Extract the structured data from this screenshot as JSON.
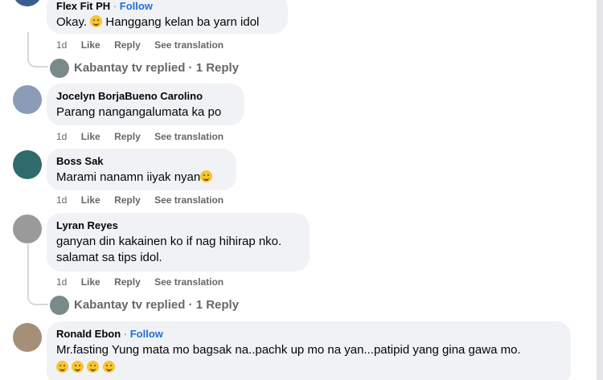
{
  "comments": [
    {
      "author": "Flex Fit PH",
      "separator": " · ",
      "follow": "Follow",
      "text": "Okay.",
      "text_after_emoji": " Hanggang kelan ba yarn idol",
      "time": "1d",
      "like": "Like",
      "reply": "Reply",
      "translate": "See translation"
    },
    {
      "author": "Jocelyn BorjaBueno Carolino",
      "text": "Parang nangangalumata ka po",
      "time": "1d",
      "like": "Like",
      "reply": "Reply",
      "translate": "See translation"
    },
    {
      "author": "Boss Sak",
      "text": "Marami nanamn iiyak nyan",
      "time": "1d",
      "like": "Like",
      "reply": "Reply",
      "translate": "See translation"
    },
    {
      "author": "Lyran Reyes",
      "text_line1": "ganyan din kakainen ko if nag hihirap nko.",
      "text_line2": "salamat sa tips idol.",
      "time": "1d",
      "like": "Like",
      "reply": "Reply",
      "translate": "See translation"
    },
    {
      "author": "Ronald Ebon",
      "separator": " · ",
      "follow": "Follow",
      "text": "Mr.fasting Yung mata mo bagsak na..pachk up mo na yan...patipid yang gina gawa mo."
    }
  ],
  "replies": [
    {
      "text": "Kabantay tv replied · 1 Reply"
    },
    {
      "text": "Kabantay tv replied · 1 Reply"
    }
  ],
  "colors": {
    "bubble": "#f0f2f5",
    "meta": "#65676b",
    "follow": "#216fdb"
  }
}
